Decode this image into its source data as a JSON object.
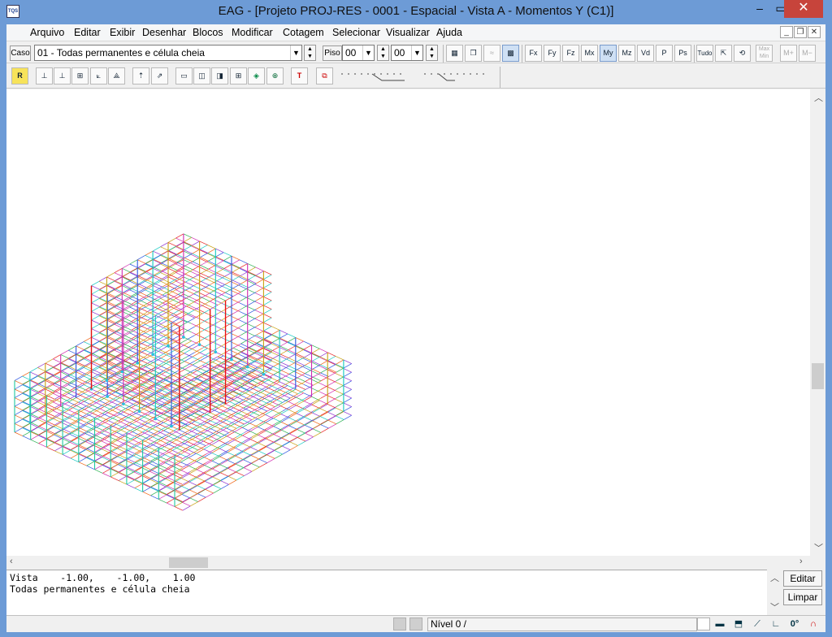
{
  "window": {
    "title": "EAG - [Projeto PROJ-RES   - 0001 - Espacial - Vista A - Momentos Y (C1)]",
    "icon_text": "TQS",
    "min_glyph": "–",
    "max_glyph": "▭",
    "close_glyph": "✕"
  },
  "menu": [
    "Arquivo",
    "Editar",
    "Exibir",
    "Desenhar",
    "Blocos",
    "Modificar",
    "Cotagem",
    "Selecionar",
    "Visualizar",
    "Ajuda"
  ],
  "mdi": {
    "min": "_",
    "restore": "❐",
    "close": "✕"
  },
  "toolbar1": {
    "caso_label": "Caso",
    "caso_value": "01 - Todas permanentes e célula cheia",
    "piso_label": "Piso",
    "piso_from": "00",
    "piso_to": "00",
    "icons": {
      "fx": "Fx",
      "fy": "Fy",
      "fz": "Fz",
      "mx": "Mx",
      "my": "My",
      "mz": "Mz",
      "vd": "Vd",
      "p": "P",
      "ps": "Ps",
      "tudo": "Tudo",
      "maxmin": "Max Min"
    }
  },
  "toolbar2": {
    "r_label": "R",
    "t_label": "T"
  },
  "console": {
    "line1": "Vista    -1.00,    -1.00,    1.00",
    "line2": "Todas permanentes e célula cheia"
  },
  "buttons": {
    "editar": "Editar",
    "limpar": "Limpar"
  },
  "status": {
    "level": "Nível 0 /",
    "angle": "0°"
  },
  "colors": {
    "column_edge": "#1ec8d8",
    "node": "#27c0e0",
    "moment_high": "#e81010"
  }
}
